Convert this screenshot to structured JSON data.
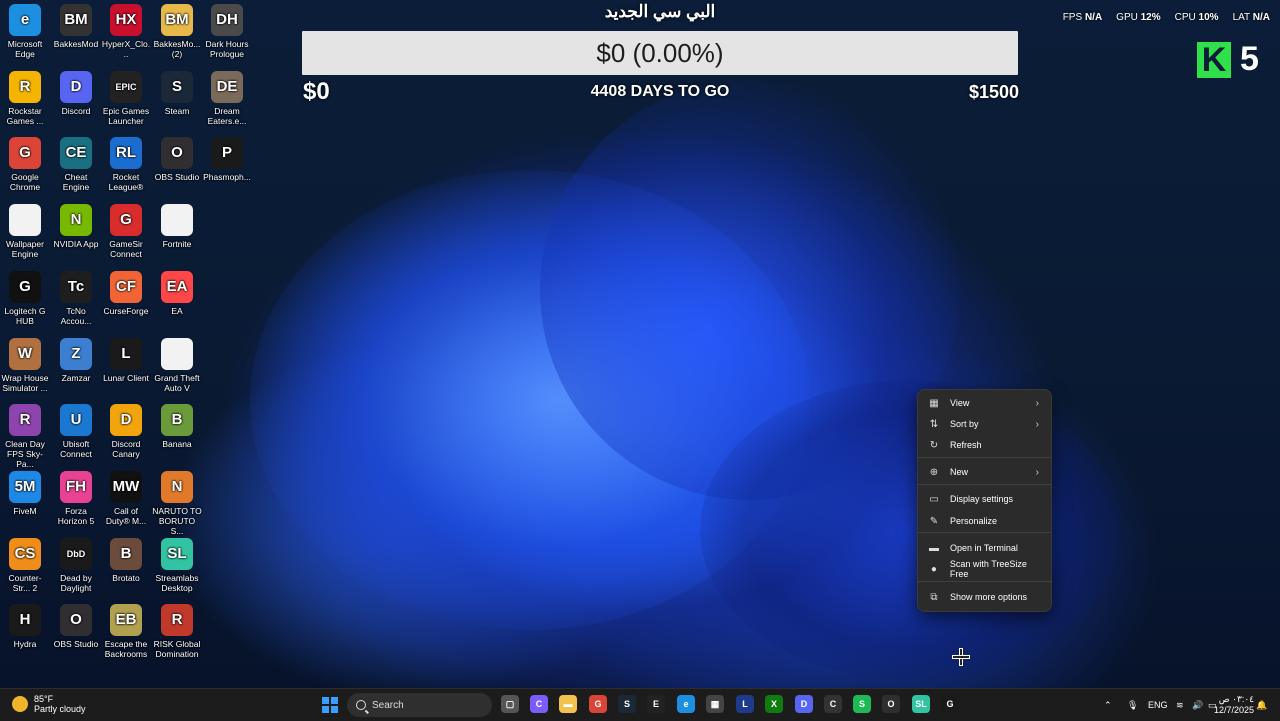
{
  "desktop": {
    "icons": [
      {
        "label": "Microsoft Edge",
        "icon": "edge-icon",
        "color": "#1d8fe0",
        "glyph": "e"
      },
      {
        "label": "BakkesMod",
        "icon": "bakkesmod-icon",
        "color": "#333333",
        "glyph": "BM"
      },
      {
        "label": "HyperX_Clo...",
        "icon": "hyperx-icon",
        "color": "#c8102e",
        "glyph": "HX"
      },
      {
        "label": "BakkesMo... (2)",
        "icon": "folder-icon",
        "color": "#e7b84a",
        "glyph": "BM"
      },
      {
        "label": "Dark Hours Prologue",
        "icon": "dark-hours-icon",
        "color": "#4a4a4a",
        "glyph": "DH"
      },
      {
        "label": "Rockstar Games ...",
        "icon": "rockstar-icon",
        "color": "#f4b400",
        "glyph": "R"
      },
      {
        "label": "Discord",
        "icon": "discord-icon",
        "color": "#5865f2",
        "glyph": "D"
      },
      {
        "label": "Epic Games Launcher",
        "icon": "epic-games-icon",
        "color": "#222222",
        "glyph": "EPIC"
      },
      {
        "label": "Steam",
        "icon": "steam-icon",
        "color": "#1b2838",
        "glyph": "S"
      },
      {
        "label": "Dream Eaters.e...",
        "icon": "dream-eaters-icon",
        "color": "#7a6a5a",
        "glyph": "DE"
      },
      {
        "label": "Google Chrome",
        "icon": "chrome-icon",
        "color": "#db4437",
        "glyph": "G"
      },
      {
        "label": "Cheat Engine",
        "icon": "cheat-engine-icon",
        "color": "#1a6f80",
        "glyph": "CE"
      },
      {
        "label": "Rocket League®",
        "icon": "rocket-league-icon",
        "color": "#1c6dd0",
        "glyph": "RL"
      },
      {
        "label": "OBS Studio",
        "icon": "obs-icon",
        "color": "#302e31",
        "glyph": "O"
      },
      {
        "label": "Phasmoph...",
        "icon": "phasmophobia-icon",
        "color": "#1a1a1a",
        "glyph": "P"
      },
      {
        "label": "Wallpaper Engine",
        "icon": "file-icon",
        "color": "#f2f2f2",
        "glyph": ""
      },
      {
        "label": "NVIDIA App",
        "icon": "nvidia-icon",
        "color": "#76b900",
        "glyph": "N"
      },
      {
        "label": "GameSir Connect",
        "icon": "gamesir-icon",
        "color": "#d92d2d",
        "glyph": "G"
      },
      {
        "label": "Fortnite",
        "icon": "file-icon",
        "color": "#f2f2f2",
        "glyph": ""
      },
      {
        "label": "",
        "icon": "",
        "color": "",
        "glyph": ""
      },
      {
        "label": "Logitech G HUB",
        "icon": "logitech-icon",
        "color": "#111111",
        "glyph": "G"
      },
      {
        "label": "TcNo Accou...",
        "icon": "tcno-icon",
        "color": "#1e1e1e",
        "glyph": "Tc"
      },
      {
        "label": "CurseForge",
        "icon": "curseforge-icon",
        "color": "#f16436",
        "glyph": "CF"
      },
      {
        "label": "EA",
        "icon": "ea-icon",
        "color": "#ff4747",
        "glyph": "EA"
      },
      {
        "label": "",
        "icon": "",
        "color": "",
        "glyph": ""
      },
      {
        "label": "Wrap House Simulator ...",
        "icon": "wrap-house-icon",
        "color": "#b07040",
        "glyph": "W"
      },
      {
        "label": "Zamzar",
        "icon": "zamzar-icon",
        "color": "#3c7fd1",
        "glyph": "Z"
      },
      {
        "label": "Lunar Client",
        "icon": "lunar-icon",
        "color": "#1a1a1a",
        "glyph": "L"
      },
      {
        "label": "Grand Theft Auto V",
        "icon": "file-icon",
        "color": "#f2f2f2",
        "glyph": ""
      },
      {
        "label": "",
        "icon": "",
        "color": "",
        "glyph": ""
      },
      {
        "label": "Clean Day FPS Sky-Pa...",
        "icon": "winrar-icon",
        "color": "#8e44ad",
        "glyph": "R"
      },
      {
        "label": "Ubisoft Connect",
        "icon": "ubisoft-icon",
        "color": "#1b78d0",
        "glyph": "U"
      },
      {
        "label": "Discord Canary",
        "icon": "discord-canary-icon",
        "color": "#f2a40c",
        "glyph": "D"
      },
      {
        "label": "Banana",
        "icon": "banana-icon",
        "color": "#6a9a3a",
        "glyph": "B"
      },
      {
        "label": "",
        "icon": "",
        "color": "",
        "glyph": ""
      },
      {
        "label": "FiveM",
        "icon": "fivem-icon",
        "color": "#1e88e5",
        "glyph": "5M"
      },
      {
        "label": "Forza Horizon 5",
        "icon": "forza-icon",
        "color": "#e84393",
        "glyph": "FH"
      },
      {
        "label": "Call of Duty® M...",
        "icon": "cod-icon",
        "color": "#111111",
        "glyph": "MW"
      },
      {
        "label": "NARUTO TO BORUTO S...",
        "icon": "naruto-icon",
        "color": "#e07a2a",
        "glyph": "N"
      },
      {
        "label": "",
        "icon": "",
        "color": "",
        "glyph": ""
      },
      {
        "label": "Counter-Str... 2",
        "icon": "cs2-icon",
        "color": "#f08c1a",
        "glyph": "CS"
      },
      {
        "label": "Dead by Daylight",
        "icon": "dbd-icon",
        "color": "#1a1a1a",
        "glyph": "DbD"
      },
      {
        "label": "Brotato",
        "icon": "brotato-icon",
        "color": "#6b4b3b",
        "glyph": "B"
      },
      {
        "label": "Streamlabs Desktop",
        "icon": "streamlabs-icon",
        "color": "#31c3a2",
        "glyph": "SL"
      },
      {
        "label": "",
        "icon": "",
        "color": "",
        "glyph": ""
      },
      {
        "label": "Hydra",
        "icon": "hydra-icon",
        "color": "#1a1a1a",
        "glyph": "H"
      },
      {
        "label": "OBS Studio",
        "icon": "obs-icon",
        "color": "#302e31",
        "glyph": "O"
      },
      {
        "label": "Escape the Backrooms",
        "icon": "escape-backrooms-icon",
        "color": "#b0a050",
        "glyph": "EB"
      },
      {
        "label": "RISK Global Domination",
        "icon": "risk-icon",
        "color": "#c0392b",
        "glyph": "R"
      },
      {
        "label": "",
        "icon": "",
        "color": "",
        "glyph": ""
      }
    ]
  },
  "goal": {
    "title": "البي سي الجديد",
    "progress_text": "$0 (0.00%)",
    "progress_fraction": 0,
    "min_label": "$0",
    "days_text": "4408 DAYS TO GO",
    "max_label": "$1500",
    "bar_color": "#e4e4e4",
    "fill_color": "#4caf50"
  },
  "stats": {
    "fps_label": "FPS",
    "fps_value": "N/A",
    "gpu_label": "GPU",
    "gpu_value": "12%",
    "cpu_label": "CPU",
    "cpu_value": "10%",
    "lat_label": "LAT",
    "lat_value": "N/A"
  },
  "kick": {
    "logo": "K",
    "count": "5",
    "color": "#2fe04a"
  },
  "context_menu": {
    "items": [
      {
        "label": "View",
        "icon": "grid-icon",
        "glyph": "▦",
        "submenu": true
      },
      {
        "label": "Sort by",
        "icon": "sort-icon",
        "glyph": "⇅",
        "submenu": true
      },
      {
        "label": "Refresh",
        "icon": "refresh-icon",
        "glyph": "↻",
        "submenu": false
      },
      {
        "label": "New",
        "icon": "new-icon",
        "glyph": "⊕",
        "submenu": true
      },
      {
        "label": "Display settings",
        "icon": "display-icon",
        "glyph": "▭",
        "submenu": false
      },
      {
        "label": "Personalize",
        "icon": "brush-icon",
        "glyph": "✎",
        "submenu": false
      },
      {
        "label": "Open in Terminal",
        "icon": "terminal-icon",
        "glyph": "▬",
        "submenu": false
      },
      {
        "label": "Scan with TreeSize Free",
        "icon": "treesize-icon",
        "glyph": "●",
        "submenu": false
      },
      {
        "label": "Show more options",
        "icon": "more-options-icon",
        "glyph": "⧉",
        "submenu": false
      }
    ],
    "submenu_arrow": "›"
  },
  "taskbar": {
    "weather_temp": "85°F",
    "weather_desc": "Partly cloudy",
    "search_placeholder": "Search",
    "apps": [
      {
        "name": "task-view-icon",
        "color": "#555555",
        "glyph": "▢"
      },
      {
        "name": "copilot-icon",
        "color": "#7b5cff",
        "glyph": "C"
      },
      {
        "name": "file-explorer-icon",
        "color": "#f2c14e",
        "glyph": "▬"
      },
      {
        "name": "chrome-taskbar-icon",
        "color": "#db4437",
        "glyph": "G"
      },
      {
        "name": "steam-taskbar-icon",
        "color": "#1b2838",
        "glyph": "S"
      },
      {
        "name": "epic-taskbar-icon",
        "color": "#222222",
        "glyph": "E"
      },
      {
        "name": "edge-taskbar-icon",
        "color": "#1d8fe0",
        "glyph": "e"
      },
      {
        "name": "store-taskbar-icon",
        "color": "#444444",
        "glyph": "▦"
      },
      {
        "name": "lunar-taskbar-icon",
        "color": "#1e3a8a",
        "glyph": "L"
      },
      {
        "name": "xbox-taskbar-icon",
        "color": "#107c10",
        "glyph": "X"
      },
      {
        "name": "discord-taskbar-icon",
        "color": "#5865f2",
        "glyph": "D"
      },
      {
        "name": "cod-taskbar-icon",
        "color": "#333333",
        "glyph": "C"
      },
      {
        "name": "spotify-taskbar-icon",
        "color": "#1db954",
        "glyph": "S"
      },
      {
        "name": "obs-taskbar-icon",
        "color": "#302e31",
        "glyph": "O"
      },
      {
        "name": "streamlabs-taskbar-icon",
        "color": "#31c3a2",
        "glyph": "SL"
      },
      {
        "name": "ghub-taskbar-icon",
        "color": "#1a1a1a",
        "glyph": "G"
      }
    ],
    "language": "ENG",
    "time": "٠٣:٠٤ ص",
    "date": "12/7/2025"
  }
}
